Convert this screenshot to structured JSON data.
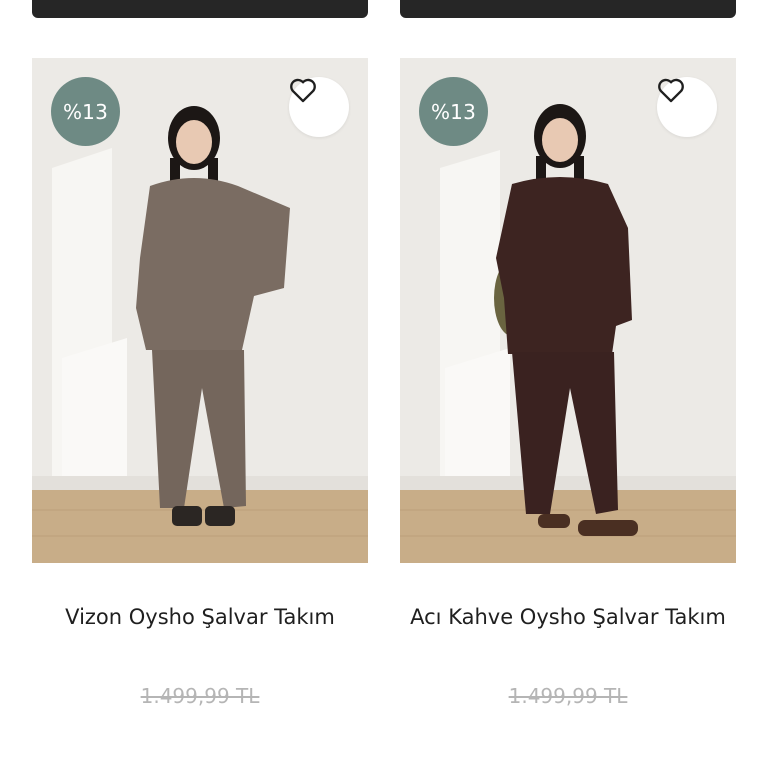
{
  "products": [
    {
      "name": "Vizon Oysho Şalvar Takım",
      "discount_badge": "%13",
      "old_price": "1.499,99 TL",
      "favorite_icon": "heart-outline-icon",
      "colors": {
        "garment": "#7a6c62",
        "hair": "#1c1715",
        "shoes": "#2b2623"
      }
    },
    {
      "name": "Acı Kahve Oysho Şalvar Takım",
      "discount_badge": "%13",
      "old_price": "1.499,99 TL",
      "favorite_icon": "heart-outline-icon",
      "colors": {
        "garment": "#3d2421",
        "hair": "#1c1715",
        "shoes": "#4a2f22"
      }
    }
  ],
  "theme": {
    "badge_bg": "#6e8a84",
    "top_button_bg": "#262626",
    "strike_price_color": "#b5b5b5"
  }
}
